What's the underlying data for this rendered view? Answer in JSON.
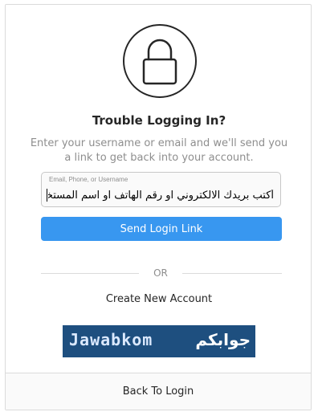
{
  "header": {
    "icon": "lock-icon",
    "title": "Trouble Logging In?",
    "description": "Enter your username or email and we'll send you a link to get back into your account."
  },
  "form": {
    "field_label": "Email, Phone, or Username",
    "field_value": "أكتب بريدك الالكتروني او رقم الهاتف او اسم المستخدم هنا",
    "send_label": "Send Login Link"
  },
  "divider": {
    "or_label": "OR"
  },
  "links": {
    "create_account": "Create New Account"
  },
  "banner": {
    "latin_text": "Jawabkom",
    "arabic_text": "جوابكم"
  },
  "footer": {
    "back_label": "Back To Login"
  },
  "colors": {
    "primary_button": "#3897f0",
    "border": "#dbdbdb",
    "muted_text": "#8e8e8e",
    "banner_bg": "#1e4f7f"
  }
}
